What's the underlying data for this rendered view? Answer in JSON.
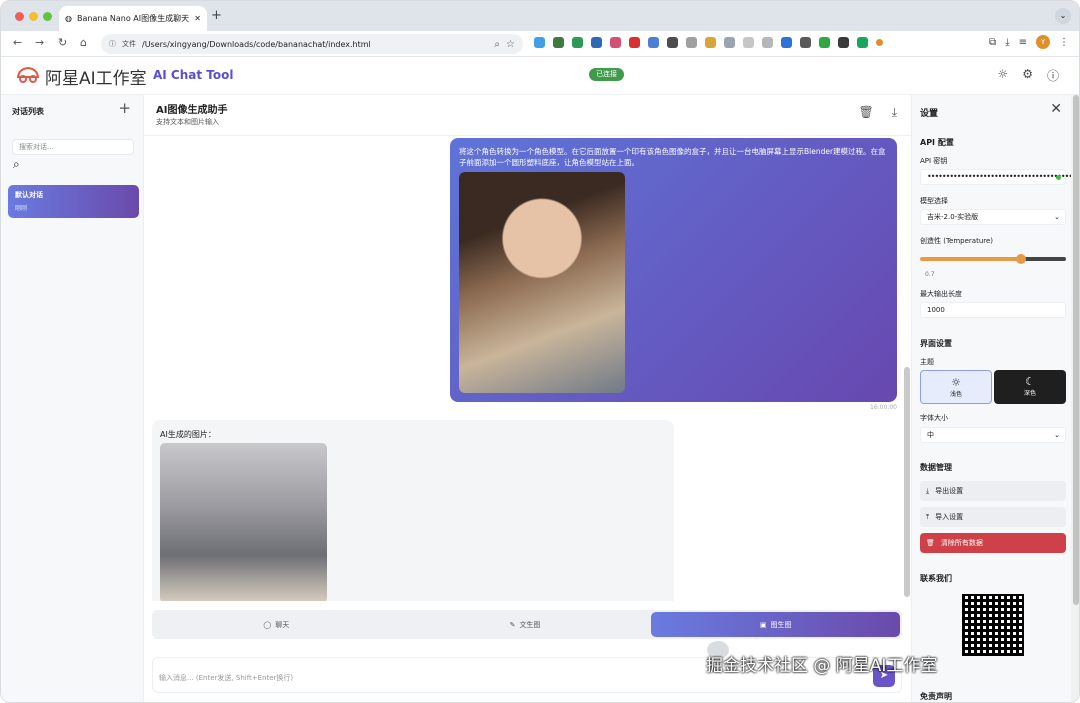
{
  "browser": {
    "tab_title": "Banana Nano AI图像生成聊天",
    "address_label": "文件",
    "address": "/Users/xingyang/Downloads/code/bananachat/index.html",
    "profile_initial": "Y",
    "new_tab": "+"
  },
  "header": {
    "brand": "阿星AI工作室",
    "subtitle": "AI Chat Tool",
    "status_badge": "已连接"
  },
  "sidebar": {
    "title": "对话列表",
    "add_button": "+",
    "search_placeholder": "搜索对话...",
    "conversations": [
      {
        "title": "默认对话",
        "time": "刚刚"
      }
    ]
  },
  "main": {
    "title": "AI图像生成助手",
    "subtitle": "支持文本和图片输入",
    "messages": [
      {
        "role": "user",
        "text": "将这个角色转换为一个角色模型。在它后面放置一个印有该角色图像的盒子，并且让一台电脑屏幕上显示Blender建模过程。在盒子前面添加一个圆形塑料底座，让角色模型站在上面。",
        "time": "16:00:00"
      },
      {
        "role": "assistant",
        "text": "AI生成的图片："
      }
    ],
    "modes": [
      {
        "label": "聊天",
        "icon": "chat-icon"
      },
      {
        "label": "文生图",
        "icon": "edit-icon"
      },
      {
        "label": "图生图",
        "icon": "image-icon",
        "active": true
      }
    ],
    "input_placeholder": "输入消息... (Enter发送, Shift+Enter换行)"
  },
  "settings": {
    "title": "设置",
    "api_section": "API 配置",
    "api_key_label": "API 密钥",
    "api_key_value": "••••••••••••••••••••••••••••••••••••••••••••••••••••",
    "model_label": "模型选择",
    "model_value": "吉米-2.0-实验版",
    "temperature_label": "创造性 (Temperature)",
    "temperature_value": "0.7",
    "max_tokens_label": "最大输出长度",
    "max_tokens_value": "1000",
    "ui_section": "界面设置",
    "theme_label": "主题",
    "theme_light": "浅色",
    "theme_dark": "深色",
    "font_label": "字体大小",
    "font_value": "中",
    "data_section": "数据管理",
    "export_label": "导出设置",
    "import_label": "导入设置",
    "clear_label": "清除所有数据",
    "contact_section": "联系我们",
    "disclaimer_section": "免责声明"
  },
  "watermark": "掘金技术社区 @ 阿星AI工作室"
}
